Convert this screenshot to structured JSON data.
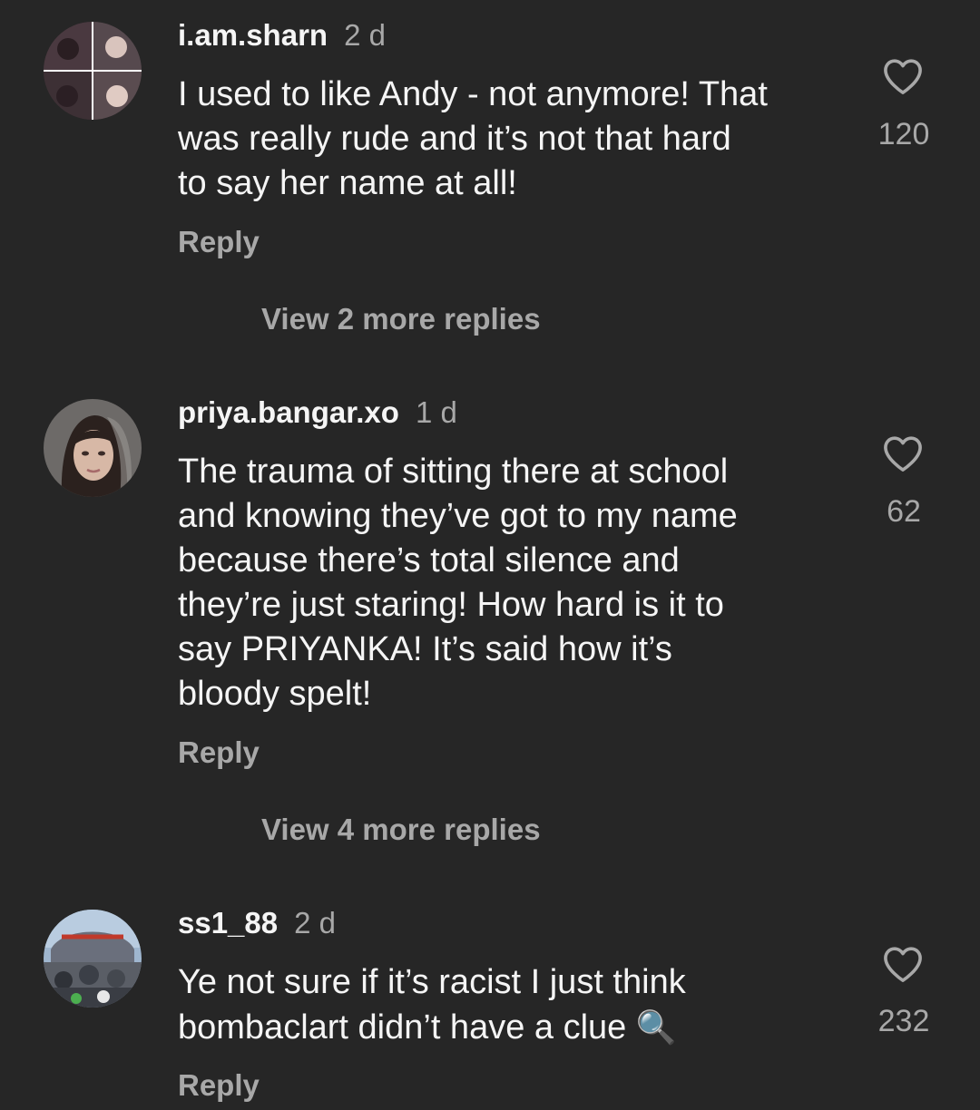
{
  "comments": [
    {
      "username": "i.am.sharn",
      "time": "2 d",
      "lines": [
        "I used to like Andy - not anymore! That",
        "was really rude and it’s not that hard",
        "to say her name at all!"
      ],
      "reply_label": "Reply",
      "likes": "120",
      "view_more": "View 2 more replies"
    },
    {
      "username": "priya.bangar.xo",
      "time": "1 d",
      "lines": [
        "The trauma of sitting there at school",
        "and knowing they’ve got to my name",
        "because there’s total silence and",
        "they’re just staring! How hard is it to",
        "say PRIYANKA! It’s said how it’s",
        "bloody spelt!"
      ],
      "reply_label": "Reply",
      "likes": "62",
      "view_more": "View 4 more replies"
    },
    {
      "username": "ss1_88",
      "time": "2 d",
      "lines": [
        "Ye not sure if it’s racist I just think",
        "bombaclart didn’t have a clue"
      ],
      "emoji": "🔍",
      "reply_label": "Reply",
      "likes": "232"
    }
  ],
  "icons": {
    "like": "heart-outline-icon",
    "magnifier": "magnifying-glass-emoji"
  },
  "colors": {
    "background": "#262626",
    "primary_text": "#f5f5f5",
    "secondary_text": "#a8a8a8"
  }
}
